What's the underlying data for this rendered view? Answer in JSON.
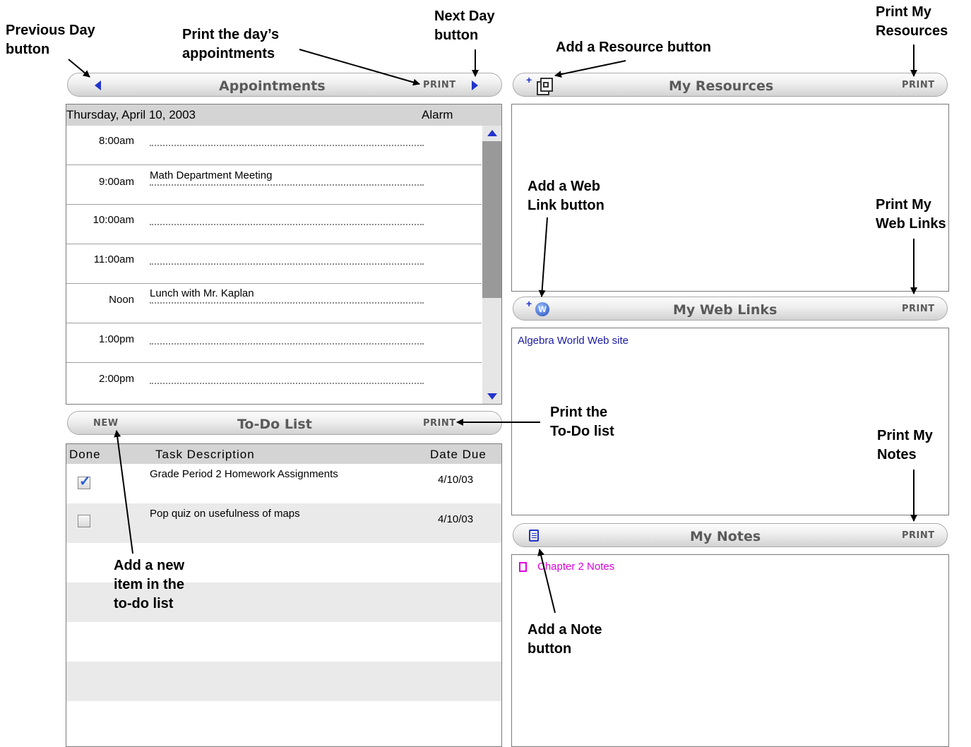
{
  "appointments": {
    "title": "Appointments",
    "print_label": "PRINT",
    "date": "Thursday, April 10, 2003",
    "alarm_label": "Alarm",
    "slots": [
      {
        "time": "8:00am",
        "text": ""
      },
      {
        "time": "9:00am",
        "text": "Math Department Meeting"
      },
      {
        "time": "10:00am",
        "text": ""
      },
      {
        "time": "11:00am",
        "text": ""
      },
      {
        "time": "Noon",
        "text": "Lunch with Mr. Kaplan"
      },
      {
        "time": "1:00pm",
        "text": ""
      },
      {
        "time": "2:00pm",
        "text": ""
      }
    ]
  },
  "todo": {
    "title": "To-Do List",
    "new_label": "NEW",
    "print_label": "PRINT",
    "columns": [
      "Done",
      "Task Description",
      "Date Due"
    ],
    "items": [
      {
        "done": true,
        "task": "Grade Period 2 Homework Assignments",
        "due": "4/10/03"
      },
      {
        "done": false,
        "task": "Pop quiz on usefulness of maps",
        "due": "4/10/03"
      }
    ]
  },
  "resources": {
    "title": "My Resources",
    "print_label": "PRINT",
    "add_prefix": "+"
  },
  "weblinks": {
    "title": "My Web Links",
    "print_label": "PRINT",
    "add_prefix": "+",
    "items": [
      "Algebra World Web site"
    ]
  },
  "notes": {
    "title": "My Notes",
    "print_label": "PRINT",
    "items": [
      "Chapter 2 Notes"
    ]
  },
  "annotations": {
    "previous_day": [
      "Previous Day",
      "button"
    ],
    "print_appointments": [
      "Print the day’s",
      "appointments"
    ],
    "next_day": [
      "Next Day",
      "button"
    ],
    "add_resource": [
      "Add a Resource button"
    ],
    "print_resources": [
      "Print My",
      "Resources"
    ],
    "add_weblink": [
      "Add a Web",
      "Link button"
    ],
    "print_weblinks": [
      "Print My",
      "Web Links"
    ],
    "print_todo": [
      "Print the",
      "To-Do list"
    ],
    "print_notes": [
      "Print My",
      "Notes"
    ],
    "add_todo": [
      "Add a new",
      "item in the",
      "to-do list"
    ],
    "add_note": [
      "Add a Note",
      "button"
    ]
  },
  "colors": {
    "scroll_arrow": "#2233cc",
    "link": "#1a1aa6",
    "note": "#e000e0",
    "header_bg": "#d4d4d4"
  }
}
